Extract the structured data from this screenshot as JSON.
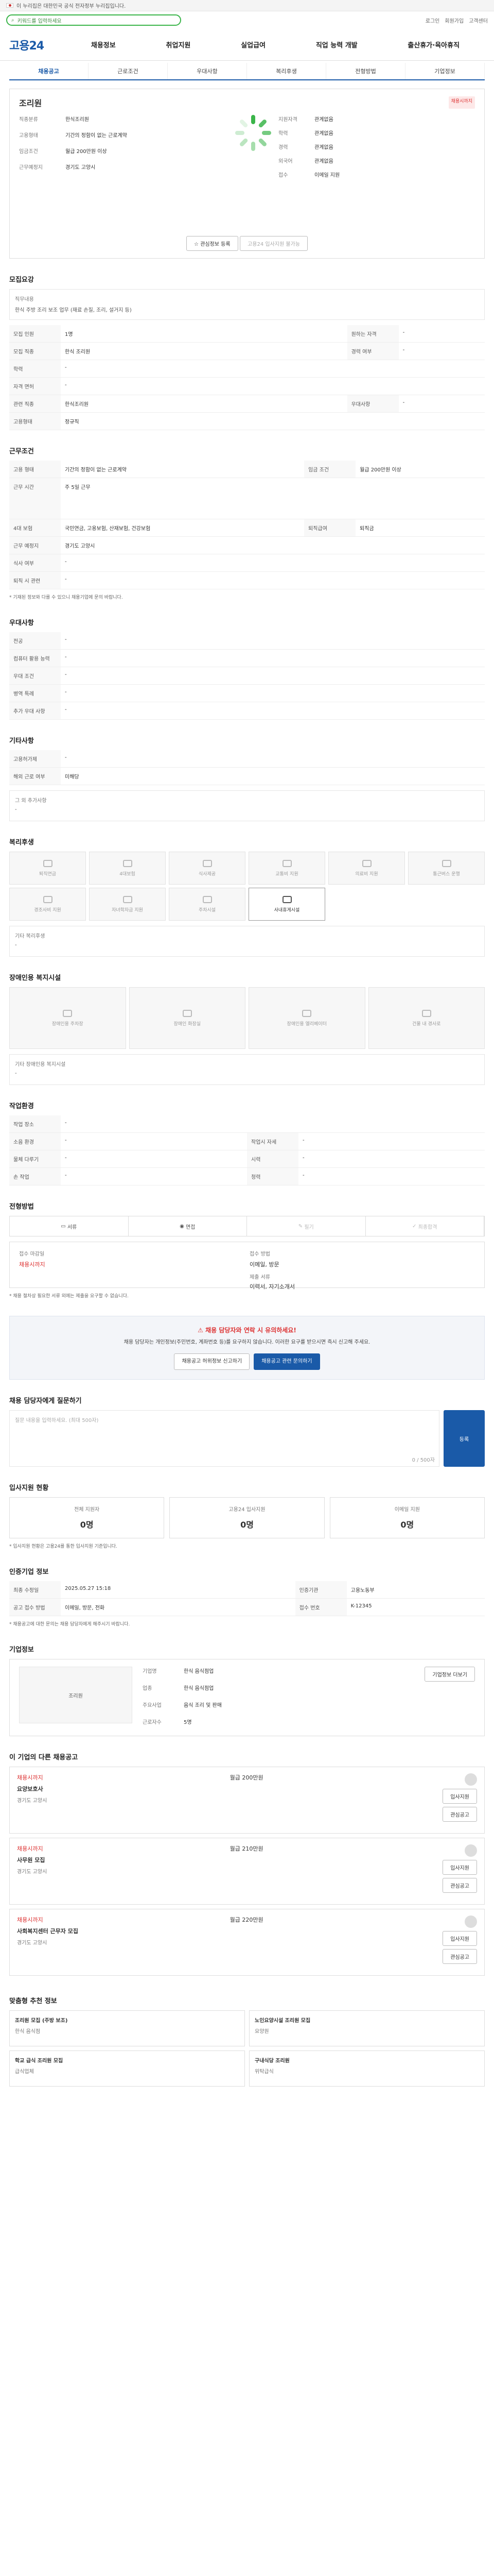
{
  "gov": {
    "notice": "이 누리집은 대한민국 공식 전자정부 누리집입니다."
  },
  "search": {
    "placeholder": "키워드를 입력하세요"
  },
  "top_links": [
    "로그인",
    "회원가입",
    "고객센터"
  ],
  "logo": "고용24",
  "gnb": [
    "채용정보",
    "취업지원",
    "실업급여",
    "직업 능력 개발",
    "출산휴가·육아휴직"
  ],
  "tabs": [
    "채용공고",
    "근로조건",
    "우대사항",
    "복리후생",
    "전형방법",
    "기업정보"
  ],
  "job": {
    "company": "조리원",
    "title_badge": "채용시까지",
    "labels": [
      "직종분류",
      "고용형태",
      "임금조건",
      "근무예정지"
    ],
    "values": [
      "한식조리원",
      "기간의 정함이 없는 근로계약",
      "월급 200만원 이상",
      "경기도 고양시"
    ],
    "right_labels": [
      "지원자격",
      "학력",
      "경력",
      "외국어"
    ],
    "right_values": [
      "관계없음",
      "관계없음",
      "관계없음",
      "관계없음"
    ],
    "apply": "이메일 지원"
  },
  "buttons": {
    "interest": "관심정보 등록",
    "print": "고용24 입사지원 불가능"
  },
  "cond": {
    "title": "모집요강",
    "duty_label": "직무내용",
    "duty": "한식 주방 조리 보조 업무 (재료 손질, 조리, 설거지 등)",
    "rows": [
      [
        "모집 인원",
        "1명",
        "원하는 자격",
        "-"
      ],
      [
        "모집 직종",
        "한식 조리원",
        "경력 여부",
        "-"
      ],
      [
        "학력",
        "-",
        "",
        ""
      ],
      [
        "자격 면허",
        "-",
        "",
        ""
      ],
      [
        "관련 직종",
        "한식조리원",
        "우대사항",
        "-"
      ],
      [
        "고용형태",
        "정규직",
        "",
        ""
      ]
    ]
  },
  "work": {
    "title": "근무조건",
    "rows": [
      [
        "고용 형태",
        "기간의 정함이 없는 근로계약",
        "임금 조건",
        "월급 200만원 이상"
      ],
      [
        "근무 시간",
        "주 5일 근무",
        "",
        ""
      ],
      [
        "4대 보험",
        "국민연금, 고용보험, 산재보험, 건강보험",
        "퇴직급여",
        "퇴직금"
      ],
      [
        "근무 예정지",
        "경기도 고양시",
        "",
        ""
      ],
      [
        "식사 여부",
        "-",
        "",
        ""
      ],
      [
        "퇴직 시 관련",
        "-",
        "",
        ""
      ]
    ],
    "note": "* 기재된 정보와 다를 수 있으니 채용기업에 문의 바랍니다."
  },
  "pref": {
    "title": "우대사항",
    "rows": [
      [
        "전공",
        "-"
      ],
      [
        "컴퓨터 활용 능력",
        "-"
      ],
      [
        "우대 조건",
        "-"
      ],
      [
        "병역 특례",
        "-"
      ],
      [
        "추가 우대 사항",
        "-"
      ]
    ]
  },
  "etc": {
    "title": "기타사항",
    "rows": [
      [
        "고용허가제",
        "-"
      ],
      [
        "해외 근로 여부",
        "미해당"
      ]
    ],
    "extra_label": "그 외 추가사항",
    "extra": "-"
  },
  "welfare": {
    "title": "복리후생",
    "tiles": [
      "퇴직연금",
      "4대보험",
      "식사제공",
      "교통비 지원",
      "의료비 지원",
      "통근버스 운행",
      "경조사비 지원",
      "자녀학자금 지원",
      "주차시설",
      "사내휴게시설"
    ],
    "extra_label": "기타 복리후생",
    "extra": "-"
  },
  "disabled": {
    "title": "장애인용 복지시설",
    "tiles": [
      "장애인용 주차장",
      "장애인 화장실",
      "장애인용 엘리베이터",
      "건물 내 경사로"
    ],
    "extra_label": "기타 장애인용 복지시설",
    "extra": "-"
  },
  "env": {
    "title": "작업환경",
    "rows": [
      [
        "작업 장소",
        "-",
        "",
        ""
      ],
      [
        "소음 환경",
        "-",
        "작업시 자세",
        "-"
      ],
      [
        "물체 다루기",
        "-",
        "시력",
        "-"
      ],
      [
        "손 작업",
        "-",
        "청력",
        "-"
      ]
    ]
  },
  "process": {
    "title": "전형방법",
    "steps": [
      "서류",
      "면접",
      "필기",
      "최종합격"
    ],
    "cols": [
      "접수 마감일",
      "접수 방법",
      "제출 서류"
    ],
    "deadline": "채용시까지",
    "method": "이메일, 방문",
    "docs": "이력서, 자기소개서"
  },
  "process_note": "* 채용 절차상 필요한 서류 외에는 제출을 요구할 수 없습니다.",
  "caution": {
    "head": "채용 담당자와 연락 시 유의하세요!",
    "body": "채용 담당자는 개인정보(주민번호, 계좌번호 등)를 요구하지 않습니다. 이러한 요구를 받으시면 즉시 신고해 주세요.",
    "btn1": "채용공고 허위정보 신고하기",
    "btn2": "채용공고 관련 문의하기"
  },
  "inquiry": {
    "title": "채용 담당자에게 질문하기",
    "placeholder": "질문 내용을 입력하세요. (최대 500자)",
    "counter": "0 / 500자",
    "submit": "등록"
  },
  "history": {
    "title": "입사지원 현황",
    "items": [
      [
        "전체 지원자",
        "0명"
      ],
      [
        "고용24 입사지원",
        "0명"
      ],
      [
        "이메일 지원",
        "0명"
      ]
    ],
    "note": "* 입사지원 현황은 고용24를 통한 입사지원 기준입니다."
  },
  "info": {
    "title": "인증기업 정보",
    "rows": [
      [
        "최종 수정일",
        "2025.05.27 15:18",
        "인증기관",
        "고용노동부"
      ],
      [
        "공고 접수 방법",
        "이메일, 방문, 전화",
        "접수 번호",
        "K-12345"
      ]
    ],
    "note": "* 채용공고에 대한 문의는 채용 담당자에게 해주시기 바랍니다."
  },
  "company": {
    "title": "기업정보",
    "name": "조리원",
    "labels": [
      "기업명",
      "업종",
      "주요사업",
      "근로자수"
    ],
    "values": [
      "한식 음식점업",
      "한식 음식점업",
      "음식 조리 및 판매",
      "5명"
    ],
    "btn": "기업정보 더보기"
  },
  "reco": {
    "title": "이 기업의 다른 채용공고",
    "items": [
      [
        "채용시까지",
        "요양보호사",
        "경기도 고양시",
        "월급 200만원"
      ],
      [
        "채용시까지",
        "사무원 모집",
        "경기도 고양시",
        "월급 210만원"
      ],
      [
        "채용시까지",
        "사회복지센터 근무자 모집",
        "경기도 고양시",
        "월급 220만원"
      ]
    ],
    "apply": "입사지원",
    "scrap": "관심공고"
  },
  "more": {
    "title": "맞춤형 추천 정보",
    "items": [
      [
        "조리원 모집 (주방 보조)",
        "한식 음식점"
      ],
      [
        "노인요양시설 조리원 모집",
        "요양원"
      ],
      [
        "학교 급식 조리원 모집",
        "급식업체"
      ],
      [
        "구내식당 조리원",
        "위탁급식"
      ]
    ]
  }
}
